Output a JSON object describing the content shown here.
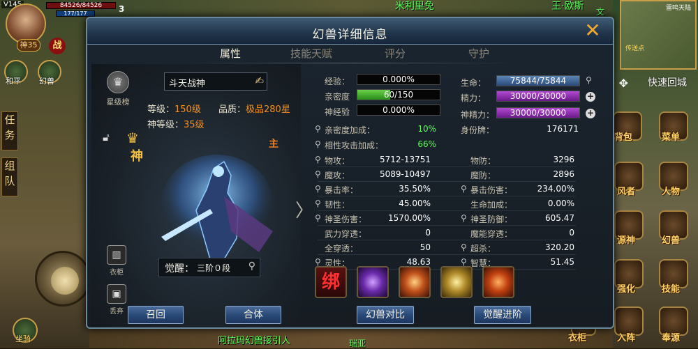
{
  "hud": {
    "level_text": "V145",
    "hp_text": "84526/84526",
    "mp_text": "177/177",
    "player_level": "3",
    "shen_badge": "神35",
    "zhan_badge": "战",
    "left_labels": [
      "和平",
      "幻兽"
    ],
    "left_tabs": [
      "任务",
      "组队"
    ],
    "npc_top_text_1": "米利里免",
    "npc_top_text_2": "王·欧斯",
    "npc_top_text_2b": "文",
    "minimap_title": "雷鸣天陆",
    "minimap_label": "传送点",
    "quick_return": "快速回城",
    "bottom_npc_text": "阿拉玛幻兽接引人",
    "bottom_npc_text2": "瑞亚",
    "bottom_left_label": "坐骑",
    "right_labels": [
      "背包",
      "菜单",
      "风者",
      "人物",
      "源神",
      "幻兽",
      "强化",
      "技能",
      "衣柜",
      "入阵",
      "奉源"
    ]
  },
  "dialog": {
    "title": "幻兽详细信息",
    "close": "✕",
    "tabs": [
      "属性",
      "技能天赋",
      "评分",
      "守护"
    ],
    "active_tab": 0
  },
  "beast": {
    "star_rank_label": "星级榜",
    "name": "斗天战神",
    "level_label": "等级：",
    "level_value": "150级",
    "quality_label": "品质：",
    "quality_value": "极品280星",
    "god_level_label": "神等级：",
    "god_level_value": "35级",
    "shen_char": "神",
    "zhu_char": "主",
    "wardrobe_label": "衣柜",
    "discard_label": "丢弃",
    "awaken_label": "觉醒：",
    "awaken_value": "三阶０段"
  },
  "stats_left": {
    "exp_label": "经验：",
    "exp_value": "0.000%",
    "exp_fraction": 0.0,
    "intimacy_label": "亲密度",
    "intimacy_value": "60/150",
    "intimacy_fraction": 0.4,
    "godexp_label": "神经验",
    "godexp_value": "0.000%",
    "godexp_fraction": 0.0,
    "intimacy_bonus_label": "亲密度加成：",
    "intimacy_bonus_value": "10%",
    "affinity_bonus_label": "相性攻击加成：",
    "affinity_bonus_value": "66%"
  },
  "stats_right": {
    "hp_label": "生命：",
    "hp_value": "75844/75844",
    "hp_fraction": 1.0,
    "energy_label": "精力：",
    "energy_value": "30000/30000",
    "energy_fraction": 1.0,
    "spirit_label": "神精力：",
    "spirit_value": "30000/30000",
    "spirit_fraction": 1.0,
    "identity_label": "身份牌：",
    "identity_value": "176171"
  },
  "attributes": [
    {
      "l_label": "物攻：",
      "l_value": "5712-13751",
      "r_label": "物防：",
      "r_value": "3296"
    },
    {
      "l_label": "魔攻：",
      "l_value": "5089-10497",
      "r_label": "魔防：",
      "r_value": "2896"
    },
    {
      "l_label": "暴击率：",
      "l_value": "35.50%",
      "r_label": "暴击伤害：",
      "r_value": "234.00%"
    },
    {
      "l_label": "韧性：",
      "l_value": "45.00%",
      "r_label": "生命加成：",
      "r_value": "0.00%"
    },
    {
      "l_label": "神圣伤害：",
      "l_value": "1570.00%",
      "r_label": "神圣防御：",
      "r_value": "605.47"
    },
    {
      "l_label": "武力穿透：",
      "l_value": "0",
      "r_label": "魔能穿透：",
      "r_value": "0"
    },
    {
      "l_label": "全穿透：",
      "l_value": "50",
      "r_label": "超杀：",
      "r_value": "320.20"
    },
    {
      "l_label": "灵性：",
      "l_value": "48.63",
      "r_label": "智慧：",
      "r_value": "51.45"
    }
  ],
  "skills": [
    {
      "name": "bind-skill",
      "text": "绑"
    },
    {
      "name": "lightning-skill",
      "text": ""
    },
    {
      "name": "fire-orb-skill",
      "text": ""
    },
    {
      "name": "gold-orb-skill",
      "text": ""
    },
    {
      "name": "flame-shield-skill",
      "text": ""
    }
  ],
  "buttons": {
    "recall": "召回",
    "merge": "合体",
    "compare": "幻兽对比",
    "awaken_advance": "觉醒进阶"
  },
  "colors": {
    "accent_orange": "#f09020",
    "green": "#5aff5a",
    "hp_bar": "#4a6a9a",
    "energy_bar": "#8a2aaa"
  }
}
